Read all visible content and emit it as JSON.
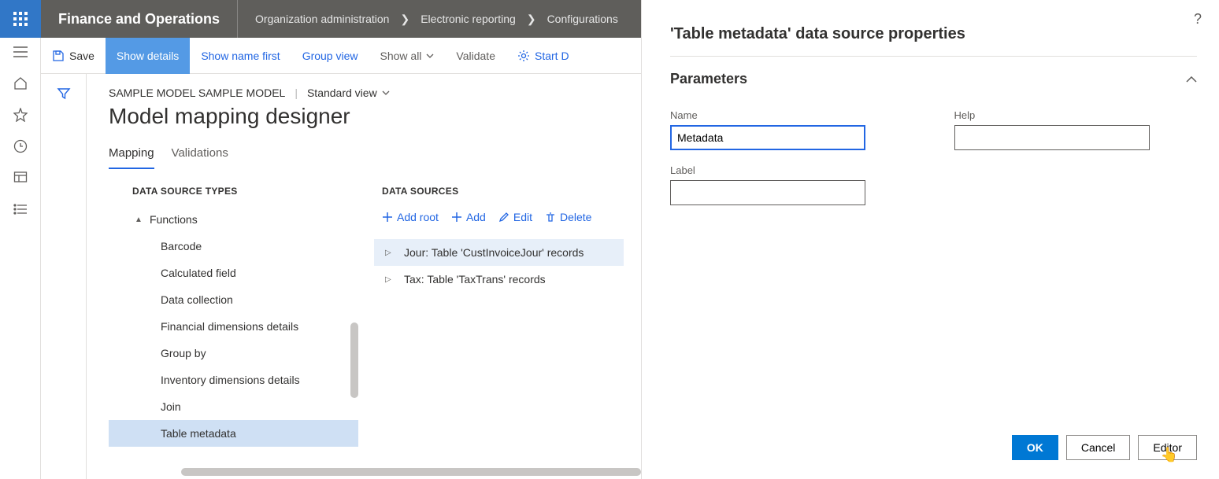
{
  "header": {
    "app": "Finance and Operations",
    "breadcrumbs": [
      "Organization administration",
      "Electronic reporting",
      "Configurations"
    ]
  },
  "commands": {
    "save": "Save",
    "show_details": "Show details",
    "show_name_first": "Show name first",
    "group_view": "Group view",
    "show_all": "Show all",
    "validate": "Validate",
    "start_d": "Start D"
  },
  "page": {
    "crumb": "SAMPLE MODEL SAMPLE MODEL",
    "view": "Standard view",
    "title": "Model mapping designer",
    "tabs": [
      "Mapping",
      "Validations"
    ]
  },
  "ds_types": {
    "header": "DATA SOURCE TYPES",
    "root": "Functions",
    "items": [
      "Barcode",
      "Calculated field",
      "Data collection",
      "Financial dimensions details",
      "Group by",
      "Inventory dimensions details",
      "Join",
      "Table metadata"
    ]
  },
  "ds": {
    "header": "DATA SOURCES",
    "actions": {
      "add_root": "Add root",
      "add": "Add",
      "edit": "Edit",
      "delete": "Delete"
    },
    "items": [
      "Jour: Table 'CustInvoiceJour' records",
      "Tax: Table 'TaxTrans' records"
    ]
  },
  "panel": {
    "title": "'Table metadata' data source properties",
    "section": "Parameters",
    "labels": {
      "name": "Name",
      "help": "Help",
      "label": "Label"
    },
    "values": {
      "name": "Metadata",
      "help": "",
      "label": ""
    },
    "buttons": {
      "ok": "OK",
      "cancel": "Cancel",
      "editor": "Editor"
    }
  }
}
